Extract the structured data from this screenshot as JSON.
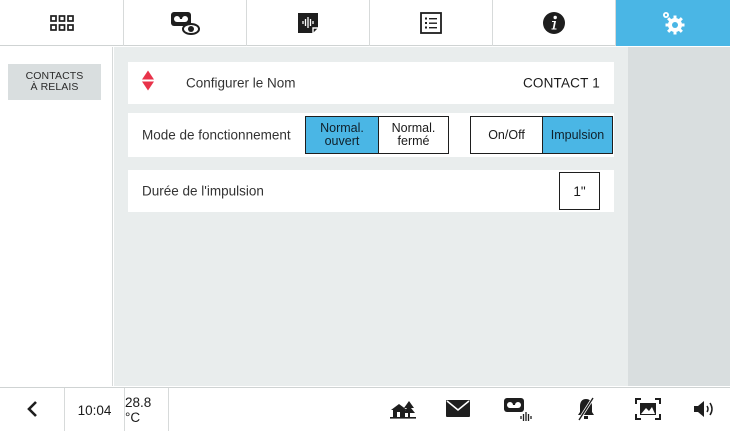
{
  "top_nav": {
    "tabs": [
      {
        "icon": "grid-icon"
      },
      {
        "icon": "video-eye-icon"
      },
      {
        "icon": "voice-message-icon"
      },
      {
        "icon": "list-icon"
      },
      {
        "icon": "info-icon"
      },
      {
        "icon": "settings-gear-icon",
        "active": true
      }
    ],
    "active_color": "#4ab6e5"
  },
  "sidebar": {
    "item_line1": "CONTACTS",
    "item_line2": "À RELAIS"
  },
  "main": {
    "name_row": {
      "label": "Configurer le Nom",
      "value": "CONTACT 1",
      "icon": "diamond-arrows-icon",
      "icon_color": "#e8334a"
    },
    "mode_row": {
      "label": "Mode de fonctionnement",
      "contact_options": [
        {
          "line1": "Normal.",
          "line2": "ouvert",
          "selected": true
        },
        {
          "line1": "Normal.",
          "line2": "fermé",
          "selected": false
        }
      ],
      "type_options": [
        {
          "label": "On/Off",
          "selected": false
        },
        {
          "label": "Impulsion",
          "selected": true
        }
      ]
    },
    "duration_row": {
      "label": "Durée de l'impulsion",
      "value": "1\""
    }
  },
  "bottom_bar": {
    "time": "10:04",
    "temperature": "28.8 °C",
    "icons": [
      "back-chevron-icon",
      "home-tree-icon",
      "mail-icon",
      "video-message-icon",
      "mute-bell-icon",
      "screen-frame-icon",
      "speaker-icon"
    ]
  }
}
